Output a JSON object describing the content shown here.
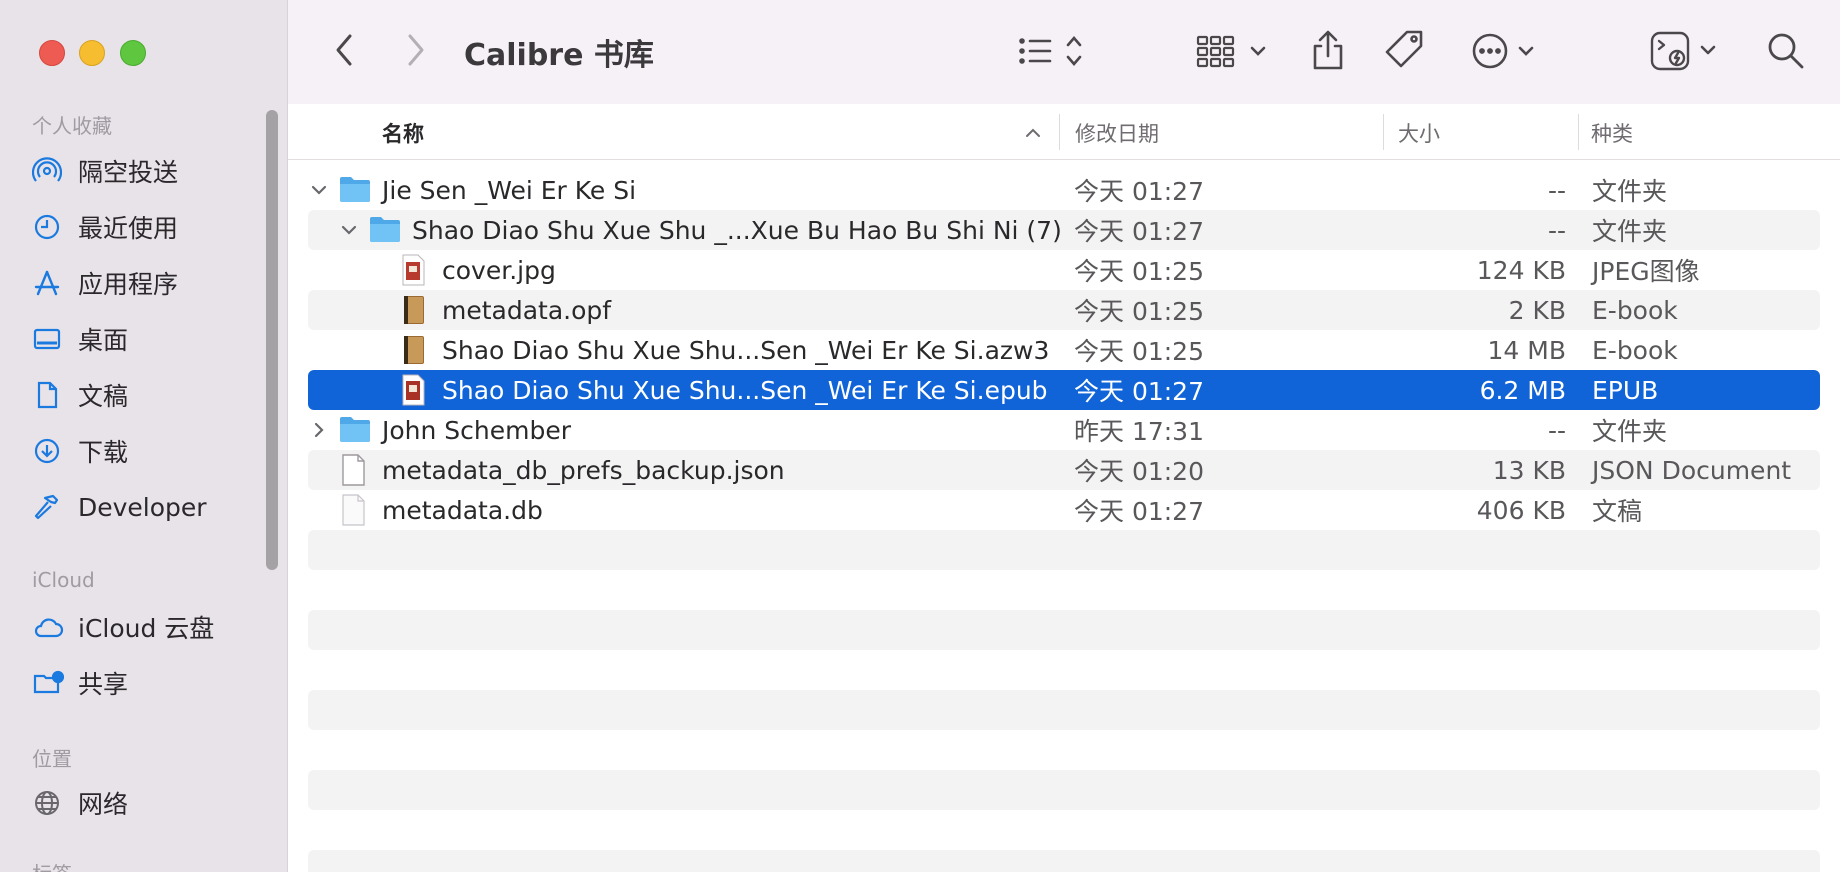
{
  "window": {
    "title": "Calibre 书库"
  },
  "sidebar": {
    "sections": [
      {
        "label": "个人收藏",
        "items": [
          {
            "label": "隔空投送",
            "icon": "airdrop-icon"
          },
          {
            "label": "最近使用",
            "icon": "clock-icon"
          },
          {
            "label": "应用程序",
            "icon": "applications-icon"
          },
          {
            "label": "桌面",
            "icon": "desktop-icon"
          },
          {
            "label": "文稿",
            "icon": "document-icon"
          },
          {
            "label": "下载",
            "icon": "download-icon"
          },
          {
            "label": "Developer",
            "icon": "hammer-icon"
          }
        ]
      },
      {
        "label": "iCloud",
        "items": [
          {
            "label": "iCloud 云盘",
            "icon": "cloud-icon"
          },
          {
            "label": "共享",
            "icon": "shared-folder-icon"
          }
        ]
      },
      {
        "label": "位置",
        "items": [
          {
            "label": "网络",
            "icon": "globe-icon"
          }
        ]
      },
      {
        "label": "标签",
        "items": []
      }
    ]
  },
  "columns": {
    "name": "名称",
    "date": "修改日期",
    "size": "大小",
    "kind": "种类"
  },
  "files": [
    {
      "name": "Jie Sen _Wei Er Ke Si",
      "date": "今天 01:27",
      "size": "--",
      "kind": "文件夹",
      "icon": "folder-icon",
      "level": 0,
      "disclosure": "expanded"
    },
    {
      "name": "Shao Diao Shu Xue Shu _...Xue Bu Hao Bu Shi Ni (7)",
      "date": "今天 01:27",
      "size": "--",
      "kind": "文件夹",
      "icon": "folder-icon",
      "level": 1,
      "disclosure": "expanded"
    },
    {
      "name": "cover.jpg",
      "date": "今天 01:25",
      "size": "124 KB",
      "kind": "JPEG图像",
      "icon": "image-file-icon",
      "level": 2,
      "disclosure": "none"
    },
    {
      "name": "metadata.opf",
      "date": "今天 01:25",
      "size": "2 KB",
      "kind": "E-book",
      "icon": "ebook-icon",
      "level": 2,
      "disclosure": "none"
    },
    {
      "name": "Shao Diao Shu Xue Shu...Sen _Wei Er Ke Si.azw3",
      "date": "今天 01:25",
      "size": "14 MB",
      "kind": "E-book",
      "icon": "ebook-icon",
      "level": 2,
      "disclosure": "none"
    },
    {
      "name": "Shao Diao Shu Xue Shu...Sen _Wei Er Ke Si.epub",
      "date": "今天 01:27",
      "size": "6.2 MB",
      "kind": "EPUB",
      "icon": "epub-icon",
      "level": 2,
      "disclosure": "none",
      "selected": true
    },
    {
      "name": "John Schember",
      "date": "昨天 17:31",
      "size": "--",
      "kind": "文件夹",
      "icon": "folder-icon",
      "level": 0,
      "disclosure": "collapsed"
    },
    {
      "name": "metadata_db_prefs_backup.json",
      "date": "今天 01:20",
      "size": "13 KB",
      "kind": "JSON Document",
      "icon": "json-file-icon",
      "level": 0,
      "disclosure": "none"
    },
    {
      "name": "metadata.db",
      "date": "今天 01:27",
      "size": "406 KB",
      "kind": "文稿",
      "icon": "blank-file-icon",
      "level": 0,
      "disclosure": "none"
    }
  ],
  "colors": {
    "selection": "#1164d8",
    "folder": "#5db8f0",
    "sidebar_icon": "#1a7ae0"
  }
}
